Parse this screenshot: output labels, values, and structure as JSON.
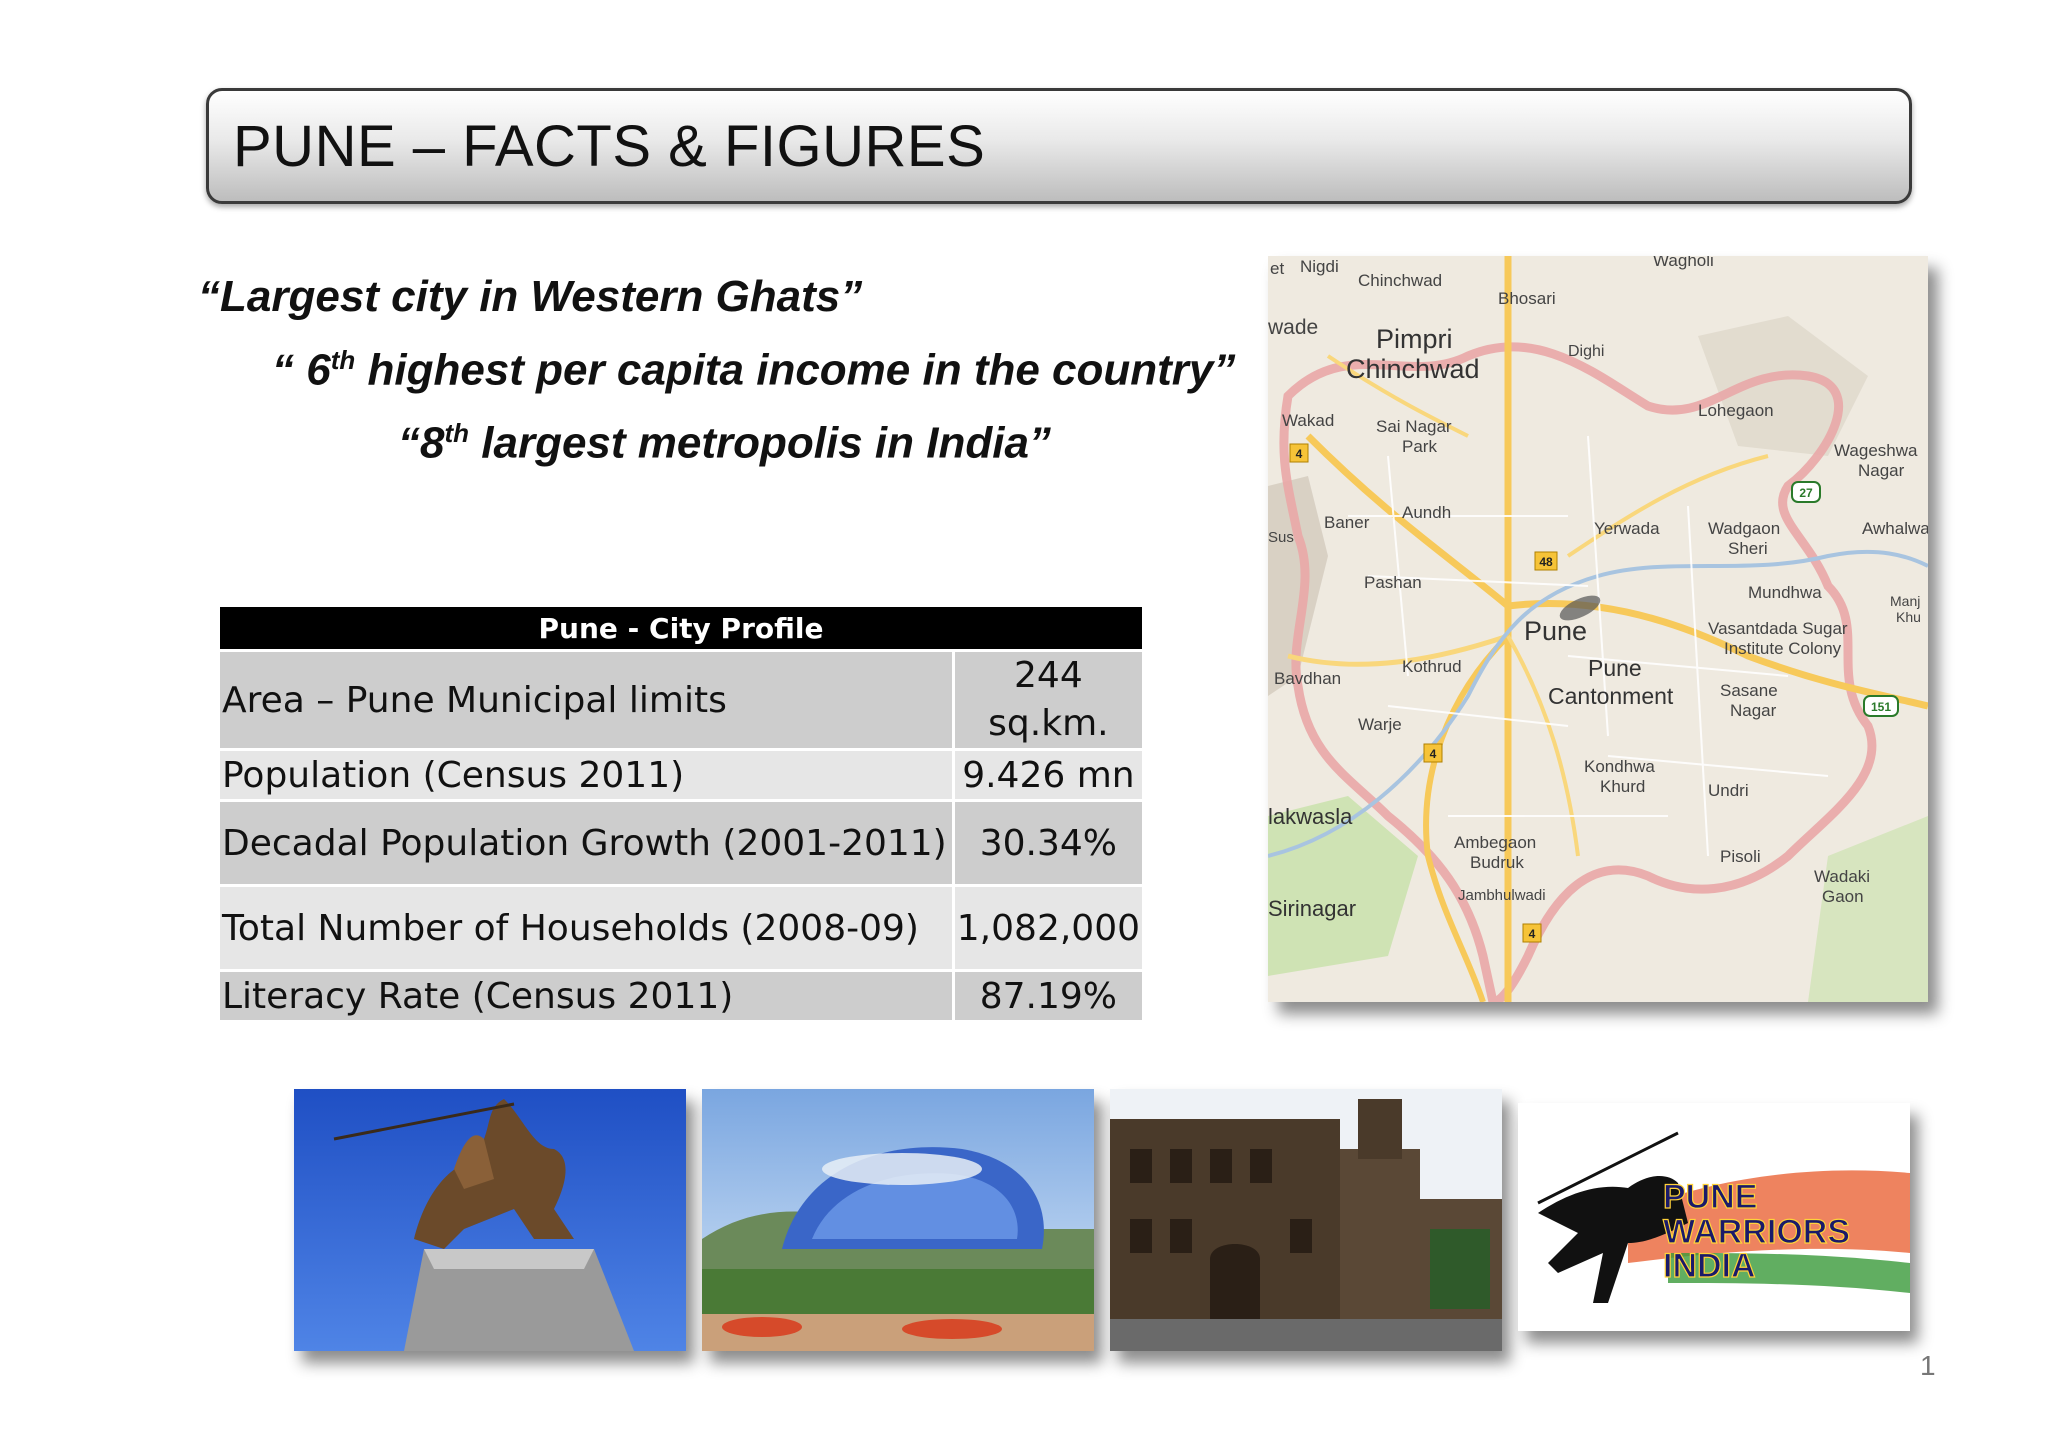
{
  "title": "PUNE – FACTS & FIGURES",
  "quotes": {
    "q1": "“Largest city in Western Ghats”",
    "q2_pre": "“ 6",
    "q2_sup": "th",
    "q2_post": " highest per capita income in the country”",
    "q3_pre": "“8",
    "q3_sup": "th",
    "q3_post": " largest metropolis in India”"
  },
  "table": {
    "header": "Pune - City Profile",
    "rows": [
      {
        "label": "Area – Pune Municipal limits",
        "value": "244 sq.km."
      },
      {
        "label": "Population (Census 2011)",
        "value": "9.426 mn"
      },
      {
        "label": "Decadal Population Growth (2001-2011)",
        "value": "30.34%"
      },
      {
        "label": "Total Number of Households (2008-09)",
        "value": "1,082,000"
      },
      {
        "label": "Literacy Rate (Census 2011)",
        "value": "87.19%"
      }
    ]
  },
  "map": {
    "labels": {
      "pune": "Pune",
      "pimpri": "Pimpri",
      "chinchwad": "Chinchwad",
      "chinchwad_small": "Chinchwad",
      "nigdi": "Nigdi",
      "bhosari": "Bhosari",
      "dighi": "Dighi",
      "wagholi": "Wagholi",
      "wakad": "Wakad",
      "sai_nagar": "Sai Nagar",
      "park": "Park",
      "lohegaon": "Lohegaon",
      "wageshwar": "Wageshwa",
      "nagar": "Nagar",
      "baner": "Baner",
      "aundh": "Aundh",
      "yerwada": "Yerwada",
      "wadgaon": "Wadgaon",
      "sheri": "Sheri",
      "awhalwa": "Awhalwa",
      "pashan": "Pashan",
      "mundhwa": "Mundhwa",
      "vasantdada": "Vasantdada Sugar",
      "institute": "Institute Colony",
      "kothrud": "Kothrud",
      "bavdhan": "Bavdhan",
      "pune_cant": "Pune",
      "cantonment": "Cantonment",
      "sasane": "Sasane",
      "sasane_nagar": "Nagar",
      "warje": "Warje",
      "kondhwa": "Kondhwa",
      "khurd": "Khurd",
      "undri": "Undri",
      "khadakwasla": "lakwasla",
      "ambegaon": "Ambegaon",
      "budruk": "Budruk",
      "pisoli": "Pisoli",
      "jambhulwadi": "Jambhulwadi",
      "wadaki": "Wadaki",
      "gaon": "Gaon",
      "sinhagad": "Sirinagar",
      "wade": "wade",
      "sus": "Sus",
      "manj": "Manj",
      "khu": "Khu",
      "et": "et",
      "hw4": "4",
      "hw4b": "4",
      "hw4c": "4",
      "hw48": "48",
      "hw27": "27",
      "hw151": "151"
    }
  },
  "photos": {
    "logo_line1": "PUNE",
    "logo_line2": "WARRIORS",
    "logo_line3": "INDIA"
  },
  "page_number": "1"
}
